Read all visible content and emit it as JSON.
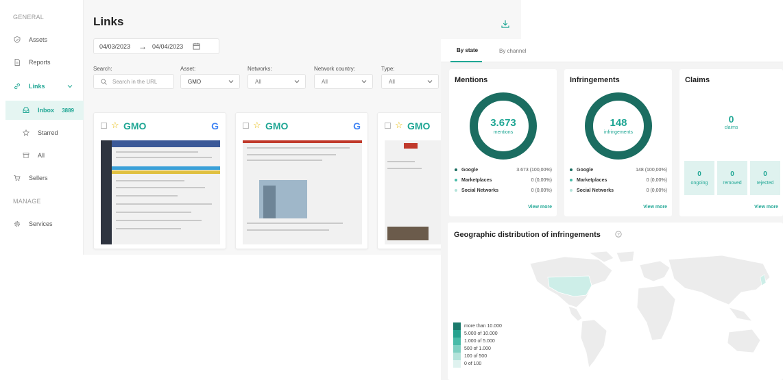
{
  "sidebar": {
    "section_general": "GENERAL",
    "section_manage": "MANAGE",
    "items": [
      {
        "label": "Assets",
        "icon": "shield-icon"
      },
      {
        "label": "Reports",
        "icon": "document-icon"
      },
      {
        "label": "Links",
        "icon": "link-icon"
      },
      {
        "label": "Inbox",
        "icon": "inbox-icon",
        "count": "3889"
      },
      {
        "label": "Starred",
        "icon": "star-icon"
      },
      {
        "label": "All",
        "icon": "archive-icon"
      },
      {
        "label": "Sellers",
        "icon": "cart-icon"
      },
      {
        "label": "Services",
        "icon": "gear-icon"
      }
    ]
  },
  "links": {
    "title": "Links",
    "date_from": "04/03/2023",
    "date_to": "04/04/2023",
    "filters": {
      "search_label": "Search:",
      "search_placeholder": "Search in the URL",
      "asset_label": "Asset:",
      "asset_value": "GMO",
      "networks_label": "Networks:",
      "networks_value": "All",
      "country_label": "Network country:",
      "country_value": "All",
      "type_label": "Type:",
      "type_value": "All"
    },
    "cards": [
      {
        "brand": "GMO",
        "source": "G"
      },
      {
        "brand": "GMO",
        "source": "G"
      },
      {
        "brand": "GMO"
      }
    ]
  },
  "dashboard": {
    "tabs": [
      "By state",
      "By channel"
    ],
    "mentions": {
      "title": "Mentions",
      "total": "3.673",
      "unit": "mentions",
      "rows": [
        {
          "name": "Google",
          "value": "3.673 (100,00%)"
        },
        {
          "name": "Marketplaces",
          "value": "0 (0,00%)"
        },
        {
          "name": "Social Networks",
          "value": "0 (0,00%)"
        }
      ],
      "view_more": "View more"
    },
    "infringements": {
      "title": "Infringements",
      "total": "148",
      "unit": "infringements",
      "rows": [
        {
          "name": "Google",
          "value": "148 (100,00%)"
        },
        {
          "name": "Marketplaces",
          "value": "0 (0,00%)"
        },
        {
          "name": "Social Networks",
          "value": "0 (0,00%)"
        }
      ],
      "view_more": "View more"
    },
    "claims": {
      "title": "Claims",
      "total": "0",
      "unit": "claims",
      "tiles": [
        {
          "value": "0",
          "label": "ongoing"
        },
        {
          "value": "0",
          "label": "removed"
        },
        {
          "value": "0",
          "label": "rejected"
        }
      ],
      "view_more": "View more"
    },
    "geo": {
      "title": "Geographic distribution of infringements",
      "legend": [
        "more than 10.000",
        "5.000 of 10.000",
        "1.000 of 5.000",
        "500 of 1.000",
        "100 of 500",
        "0 of 100"
      ]
    }
  },
  "colors": {
    "accent": "#1fa694",
    "donut": "#1b6d61",
    "legend": [
      "#1b7a6c",
      "#26a28f",
      "#48bba8",
      "#7fd0c2",
      "#b4e3da",
      "#dff2ef"
    ]
  }
}
